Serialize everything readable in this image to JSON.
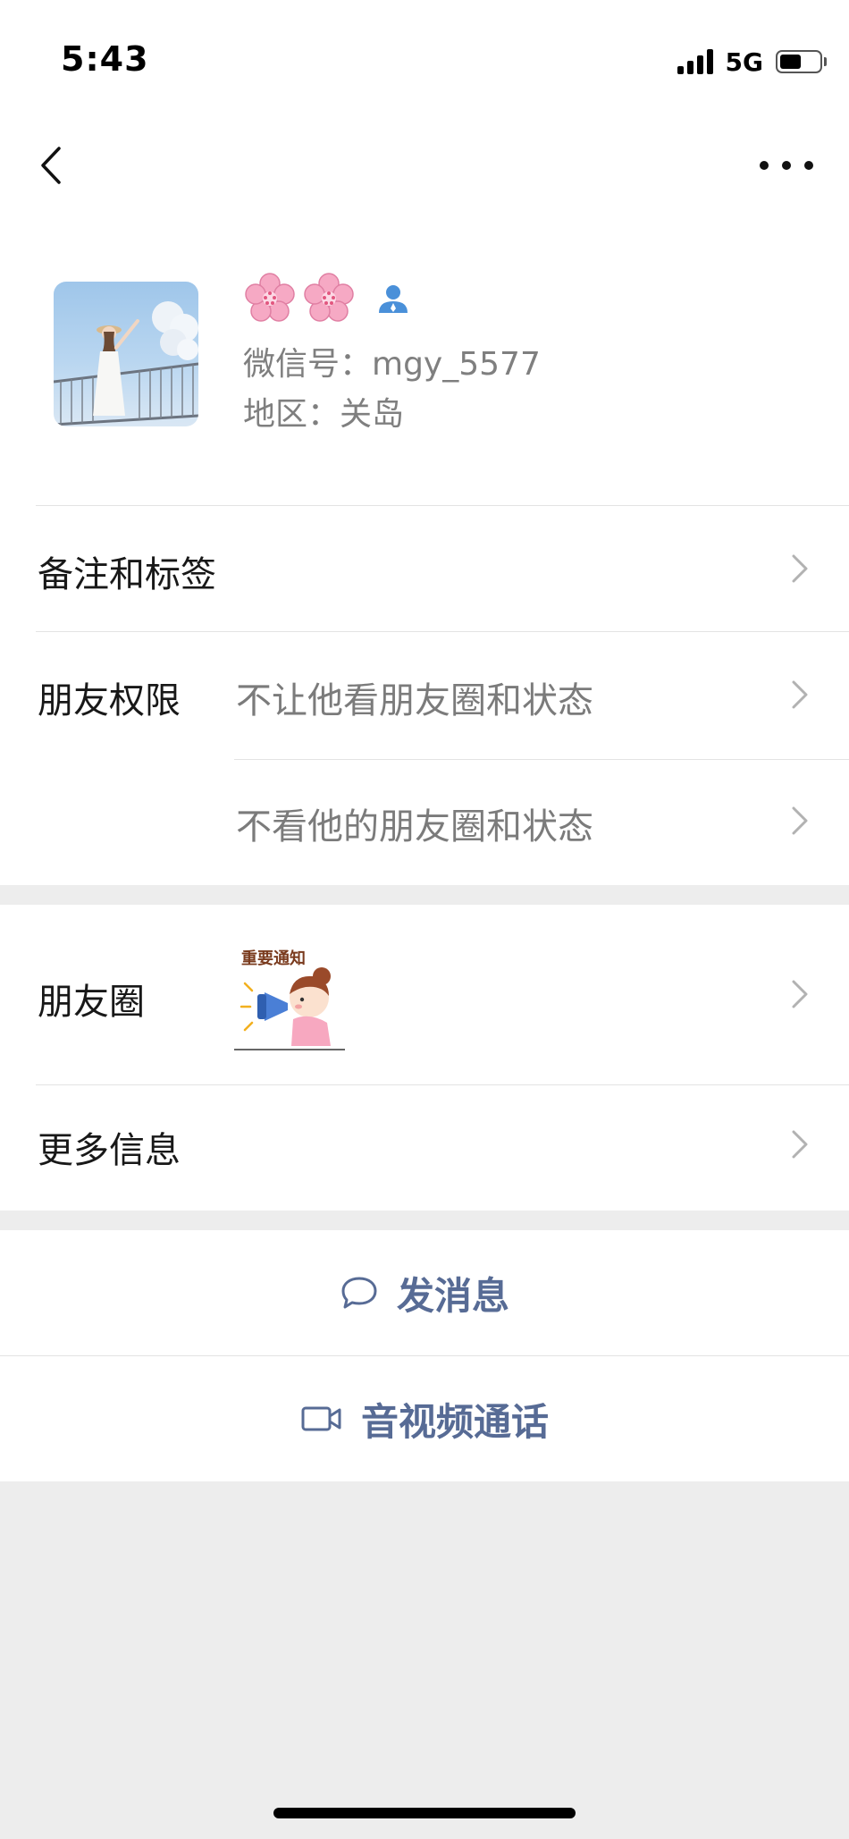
{
  "status_bar": {
    "time": "5:43",
    "network": "5G",
    "battery_level": 0.55
  },
  "nav": {
    "back_icon": "chevron-left-icon",
    "more_icon": "more-dots-icon"
  },
  "profile": {
    "display_name_emoji": "🌸🌸",
    "wechat_id": "微信号：mgy_5577",
    "region": "地区：关岛"
  },
  "rows": {
    "remark_tags": "备注和标签",
    "friend_permissions": "朋友权限",
    "hide_my_moments": "不让他看朋友圈和状态",
    "hide_their_moments": "不看他的朋友圈和状态",
    "moments": "朋友圈",
    "more_info": "更多信息"
  },
  "moments_thumb": {
    "caption": "重要通知"
  },
  "actions": {
    "send_message": "发消息",
    "video_call": "音视频通话"
  },
  "colors": {
    "link_blue": "#576b95",
    "background_gray": "#ededed",
    "divider": "#e3e3e3"
  }
}
